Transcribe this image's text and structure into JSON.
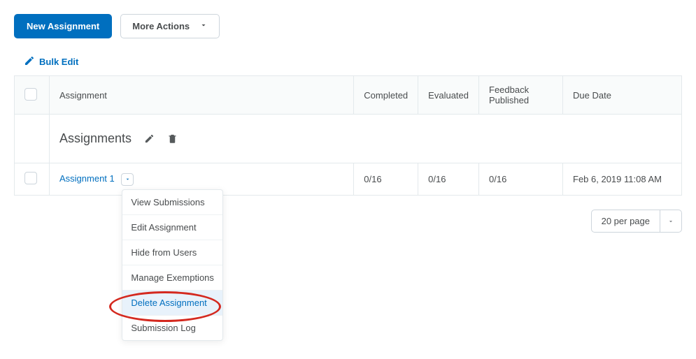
{
  "toolbar": {
    "new_assignment": "New Assignment",
    "more_actions": "More Actions"
  },
  "bulk_edit": "Bulk Edit",
  "columns": {
    "assignment": "Assignment",
    "completed": "Completed",
    "evaluated": "Evaluated",
    "feedback": "Feedback Published",
    "due": "Due Date"
  },
  "category": {
    "title": "Assignments"
  },
  "rows": [
    {
      "name": "Assignment 1",
      "completed": "0/16",
      "evaluated": "0/16",
      "feedback": "0/16",
      "due": "Feb 6, 2019 11:08 AM"
    }
  ],
  "menu": {
    "view_submissions": "View Submissions",
    "edit_assignment": "Edit Assignment",
    "hide_from_users": "Hide from Users",
    "manage_exemptions": "Manage Exemptions",
    "delete_assignment": "Delete Assignment",
    "submission_log": "Submission Log"
  },
  "pager": {
    "per_page": "20 per page"
  }
}
